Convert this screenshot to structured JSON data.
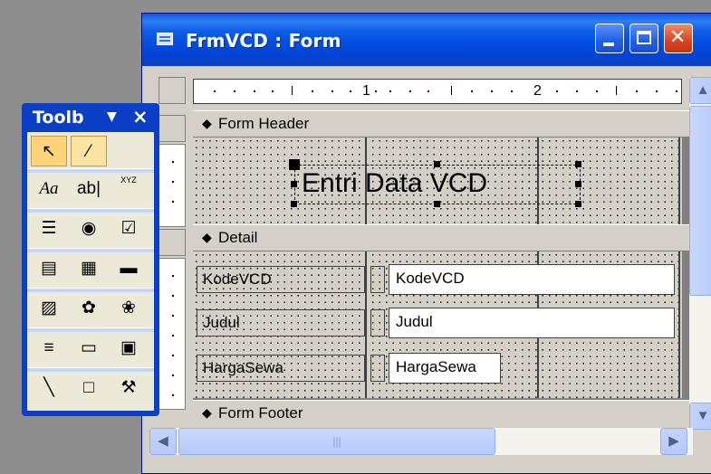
{
  "window": {
    "title": "FrmVCD : Form",
    "buttons": {
      "minimize": "minimize",
      "maximize": "maximize",
      "close": "close"
    }
  },
  "ruler": {
    "marks": [
      "1",
      "2"
    ]
  },
  "sections": {
    "header": "Form Header",
    "detail": "Detail",
    "footer": "Form Footer"
  },
  "header_label": "Entri Data VCD",
  "fields": [
    {
      "label": "KodeVCD",
      "value": "KodeVCD"
    },
    {
      "label": "Judul",
      "value": "Judul"
    },
    {
      "label": "HargaSewa",
      "value": "HargaSewa"
    }
  ],
  "toolbox": {
    "title": "Toolb",
    "tools": [
      "select-objects",
      "control-wizards",
      "label",
      "text-box",
      "option-group",
      "toggle-button",
      "option-button",
      "check-box",
      "combo-box",
      "list-box",
      "command-button",
      "image",
      "unbound-object-frame",
      "bound-object-frame",
      "page-break",
      "tab-control",
      "subform",
      "line",
      "rectangle",
      "more-controls"
    ],
    "glyphs": {
      "label": "Aa",
      "text_box": "ab|",
      "option_group": "XYZ"
    }
  },
  "colors": {
    "title_bar": "#0a58e8",
    "grid_bg": "#d4d0c8",
    "selected_tool": "#ffd37a"
  }
}
